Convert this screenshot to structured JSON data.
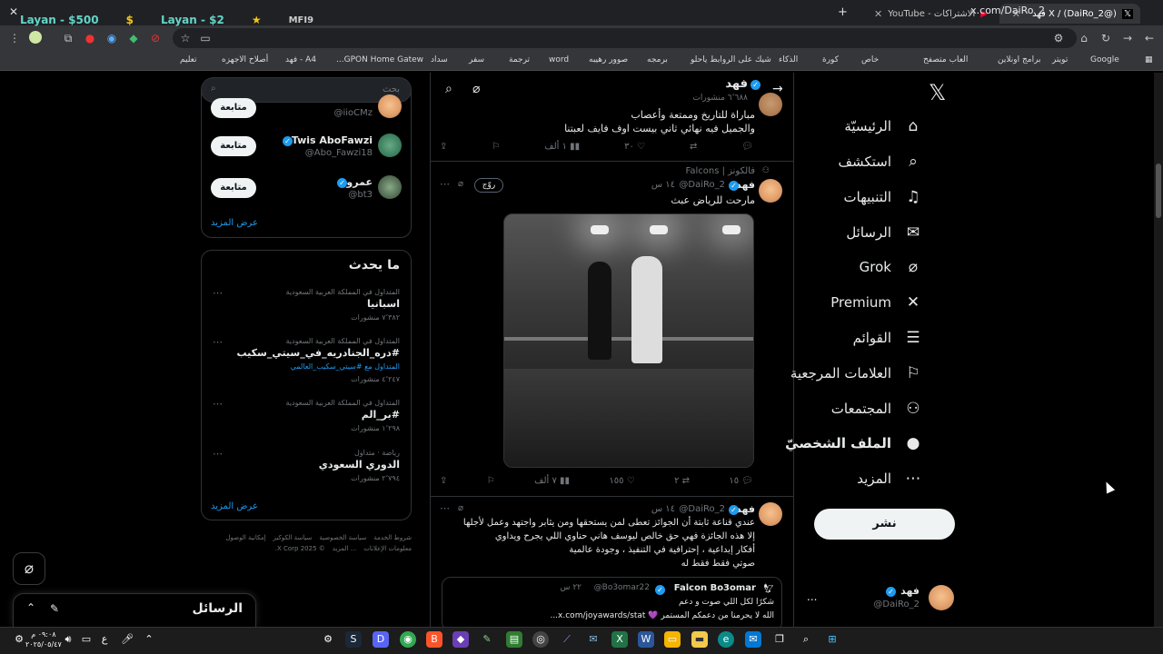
{
  "browser": {
    "tabs": [
      {
        "title": "X / (DaiRo_2@) فهد",
        "active": true
      },
      {
        "title": "الاشتراكات - YouTube",
        "active": false
      }
    ],
    "new_tab": "+",
    "url": "x.com/DaiRo_2",
    "bookmarks": [
      "Google",
      "تويتر",
      "برامج اونلاين",
      "العاب متصفح",
      "خاص",
      "كورة",
      "الذكاء",
      "شيك على الروابط ياحلو",
      "برمجه",
      "صوور رهيبه",
      "word",
      "ترجمة",
      "سفر",
      "سداد",
      "GPON Home Gatew...",
      "A4 - فهد",
      "أصلاح الاجهزه",
      "تعليم"
    ]
  },
  "overlay": {
    "items": [
      "Layan - $500",
      "Layan - $2",
      "MFI9"
    ]
  },
  "sidebar": {
    "items": [
      {
        "label": "الرئيسيّة",
        "icon": "home-icon",
        "glyph": "⌂"
      },
      {
        "label": "استكشف",
        "icon": "search-icon",
        "glyph": "⌕"
      },
      {
        "label": "التنبيهات",
        "icon": "bell-icon",
        "glyph": "🔔"
      },
      {
        "label": "الرسائل",
        "icon": "mail-icon",
        "glyph": "✉"
      },
      {
        "label": "Grok",
        "icon": "grok-icon",
        "glyph": "⌀"
      },
      {
        "label": "Premium",
        "icon": "x-icon",
        "glyph": "✕"
      },
      {
        "label": "القوائم",
        "icon": "list-icon",
        "glyph": "☰"
      },
      {
        "label": "العلامات المرجعية",
        "icon": "bookmark-icon",
        "glyph": "🔖"
      },
      {
        "label": "المجتمعات",
        "icon": "communities-icon",
        "glyph": "👥"
      },
      {
        "label": "الملف الشخصيّ",
        "icon": "profile-icon",
        "glyph": "👤"
      },
      {
        "label": "المزيد",
        "icon": "more-icon",
        "glyph": "⋯"
      }
    ],
    "post_button": "نشر",
    "account": {
      "name": "فهد",
      "handle": "@DaiRo_2",
      "more": "..."
    }
  },
  "header": {
    "name": "فهد",
    "posts_count": "٦٬٦٨٨ منشورات"
  },
  "posts": [
    {
      "text_lines": [
        "مباراة للتاريخ وممتعة وأعصاب",
        "والجميل فيه نهائي ثاني بيست اوف فايف لعبتنا"
      ],
      "stats": {
        "replies": "",
        "reposts": "",
        "likes": "٣٠",
        "views": "١ ألف"
      }
    },
    {
      "community": "فالكونز | Falcons",
      "author": "فهد",
      "handle": "@DaiRo_2",
      "time": "١٤ س",
      "badge": "روّج",
      "text": "مارحت للرياض عبث",
      "stats": {
        "replies": "١٥",
        "reposts": "٢",
        "likes": "١٥٥",
        "views": "٧ ألف"
      }
    },
    {
      "author": "فهد",
      "handle": "@DaiRo_2",
      "time": "١٤ س",
      "text_lines": [
        "عندي قناعة ثابتة أن الجوائز تعطى لمن يستحقها ومن يثابر واجتهد وعمل لأجلها",
        "إلا هذه الجائزة فهي حق خالص ليوسف هاني حناوي اللي يجرح ويداوي",
        "أفكار إبداعية ، إحترافية في التنفيذ ، وجودة عالمية",
        "صوتي فقط فقط له"
      ],
      "quote": {
        "author": "Falcon Bo3omar",
        "handle": "@Bo3omar22",
        "time": "٢٢ س",
        "lines": [
          "شكرًا لكل اللي صوت و دعم",
          "الله لا يحرمنا من دعمكم المستمر 💜 x.com/joyawards/stat..."
        ]
      }
    }
  ],
  "search": {
    "placeholder": "بحث"
  },
  "who_to_follow": {
    "users": [
      {
        "name": "",
        "handle": "@iioCMz",
        "button": "متابعة"
      },
      {
        "name": "Twis AboFawzi",
        "handle": "@Abo_Fawzi18",
        "button": "متابعة"
      },
      {
        "name": "عمرو",
        "handle": "@bt3",
        "button": "متابعة"
      }
    ],
    "show_more": "عرض المزيد"
  },
  "trends": {
    "title": "ما يحدث",
    "items": [
      {
        "context": "المتداول في المملكة العربية السعودية",
        "title": "اسبانيا",
        "extra": "",
        "count": "٧٬٣٨٢ منشورات"
      },
      {
        "context": "المتداول في المملكة العربية السعودية",
        "title": "#دره_الجنادريه_في_سيتي_سكيب",
        "extra": "المتداول مع #سيتي_سكيب_العالمي",
        "count": "٤٬٢٤٧ منشورات"
      },
      {
        "context": "المتداول في المملكة العربية السعودية",
        "title": "#بر_الم",
        "extra": "",
        "count": "١٬٢٩٨ منشورات"
      },
      {
        "context": "رياضة · متداول",
        "title": "الدوري السعودي",
        "extra": "",
        "count": "٢٬٧٩٤ منشورات"
      }
    ],
    "show_more": "عرض المزيد"
  },
  "footer": {
    "links": [
      "شروط الخدمة",
      "سياسة الخصوصية",
      "سياسة الكوكيز",
      "إمكانية الوصول",
      "معلومات الإعلانات",
      "... المزيد",
      "© 2025 X Corp."
    ]
  },
  "messages_drawer": {
    "title": "الرسائل"
  },
  "taskbar": {
    "time": "٠٩:٠٨ م",
    "date": "٢٠٢٥/٠٥/٤٧",
    "lang": "ع"
  },
  "colors": {
    "accent": "#1d9bf0",
    "bg": "#000000",
    "border": "#2f3336",
    "muted": "#71767b"
  }
}
